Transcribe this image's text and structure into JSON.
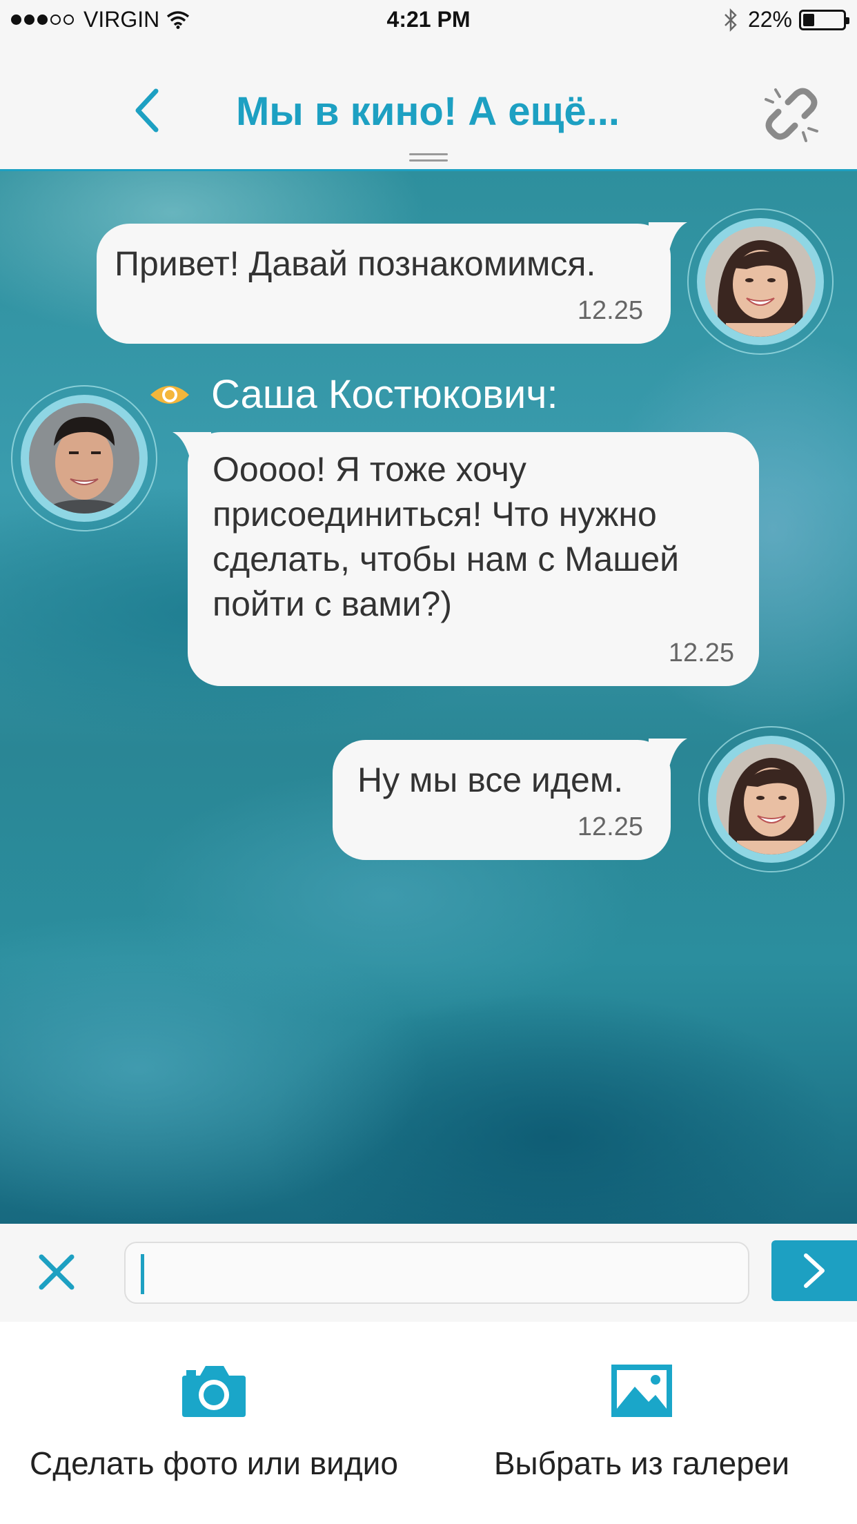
{
  "status_bar": {
    "carrier": "VIRGIN",
    "time": "4:21 PM",
    "battery": "22%"
  },
  "header": {
    "title": "Мы в кино! А ещё..."
  },
  "messages": [
    {
      "text": "Привет! Давай познакомимся.",
      "time": "12.25",
      "direction": "outgoing"
    },
    {
      "sender": "Саша Костюкович:",
      "text": "Ооооо! Я тоже хочу присоединиться! Что нужно сделать, чтобы нам с Машей пойти с вами?)",
      "time": "12.25",
      "direction": "incoming"
    },
    {
      "text": "Ну мы все идем.",
      "time": "12.25",
      "direction": "outgoing"
    }
  ],
  "input": {
    "value": ""
  },
  "attach": {
    "camera_label": "Сделать фото или видио",
    "gallery_label": "Выбрать из галереи"
  },
  "colors": {
    "accent": "#1da0c2",
    "sender_eye": "#f4b63b"
  },
  "icons": [
    "back-icon",
    "unlink-icon",
    "eye-icon",
    "close-icon",
    "send-arrow-icon",
    "camera-icon",
    "gallery-icon"
  ]
}
